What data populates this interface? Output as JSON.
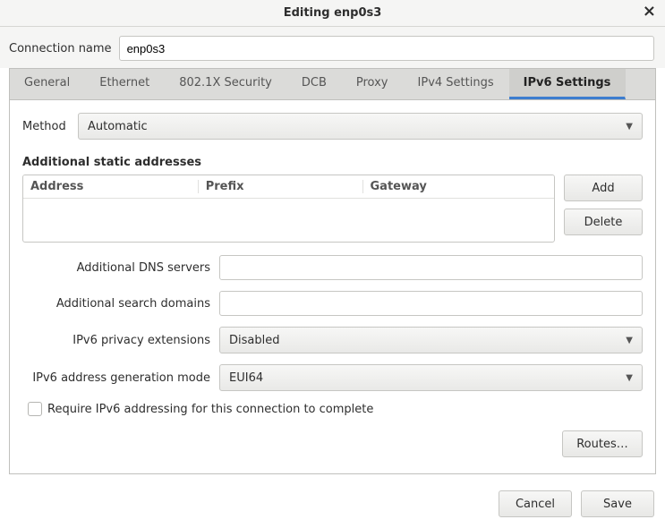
{
  "title": "Editing enp0s3",
  "connection_name_label": "Connection name",
  "connection_name_value": "enp0s3",
  "tabs": {
    "general": "General",
    "ethernet": "Ethernet",
    "security": "802.1X Security",
    "dcb": "DCB",
    "proxy": "Proxy",
    "ipv4": "IPv4 Settings",
    "ipv6": "IPv6 Settings"
  },
  "method_label": "Method",
  "method_value": "Automatic",
  "addresses_label": "Additional static addresses",
  "addr_columns": {
    "address": "Address",
    "prefix": "Prefix",
    "gateway": "Gateway"
  },
  "buttons": {
    "add": "Add",
    "delete": "Delete",
    "routes": "Routes…",
    "cancel": "Cancel",
    "save": "Save"
  },
  "labels": {
    "dns": "Additional DNS servers",
    "domains": "Additional search domains",
    "privacy": "IPv6 privacy extensions",
    "genmode": "IPv6 address generation mode",
    "require": "Require IPv6 addressing for this connection to complete"
  },
  "values": {
    "dns": "",
    "domains": "",
    "privacy": "Disabled",
    "genmode": "EUI64",
    "require_checked": false
  }
}
